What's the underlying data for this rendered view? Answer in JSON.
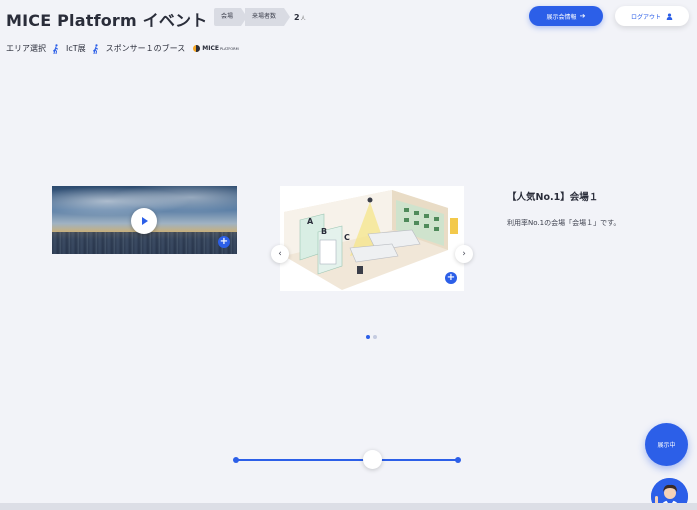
{
  "header": {
    "title": "MICE Platform イベント",
    "breadcrumbs": [
      "会場",
      "来場者数"
    ],
    "visitor_count": "2",
    "visitor_unit": "人",
    "exhibit_button": "展示会情報",
    "logout_button": "ログアウト"
  },
  "area_nav": {
    "area_select": "エリア選択",
    "floor": "IcT展",
    "booth": "スポンサー１のブース",
    "logo_main": "MICE",
    "logo_sub": "PLATFORM"
  },
  "carousel": {
    "title": "【人気No.1】会場１",
    "description": "利用率No.1の会場「会場１」です。",
    "dots": 2,
    "active_dot": 0
  },
  "fab": {
    "label": "展示中"
  },
  "colors": {
    "accent": "#2c5fe8",
    "background": "#f2f3f8"
  },
  "icons": [
    "walking-person-icon",
    "play-icon",
    "plus-icon",
    "arrow-right-icon",
    "user-icon",
    "chevron-left-icon",
    "chevron-right-icon"
  ]
}
